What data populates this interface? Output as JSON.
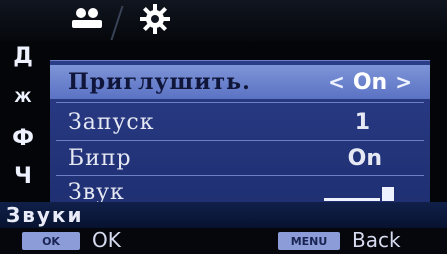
{
  "tabs": [
    {
      "icon": "people-icon"
    },
    {
      "icon": "gear-icon"
    }
  ],
  "left_menu": [
    "Д",
    "Ж",
    "Ф",
    "Ч"
  ],
  "panel": {
    "rows": [
      {
        "label": "Приглушить.",
        "value": "On",
        "selected": true
      },
      {
        "label": "Запуск",
        "value": "1"
      },
      {
        "label": "Бипр",
        "value": "On"
      },
      {
        "label": "Звук",
        "volume_level": 0.8
      }
    ]
  },
  "section_title": "Звуки",
  "bottom_bar": {
    "ok_key": "OK",
    "ok_text": "OK",
    "menu_key": "MENU",
    "back_text": "Back"
  },
  "colors": {
    "panel": "#24357a",
    "selected_row": "#6e86cf",
    "key_badge": "#8c9cd9"
  }
}
